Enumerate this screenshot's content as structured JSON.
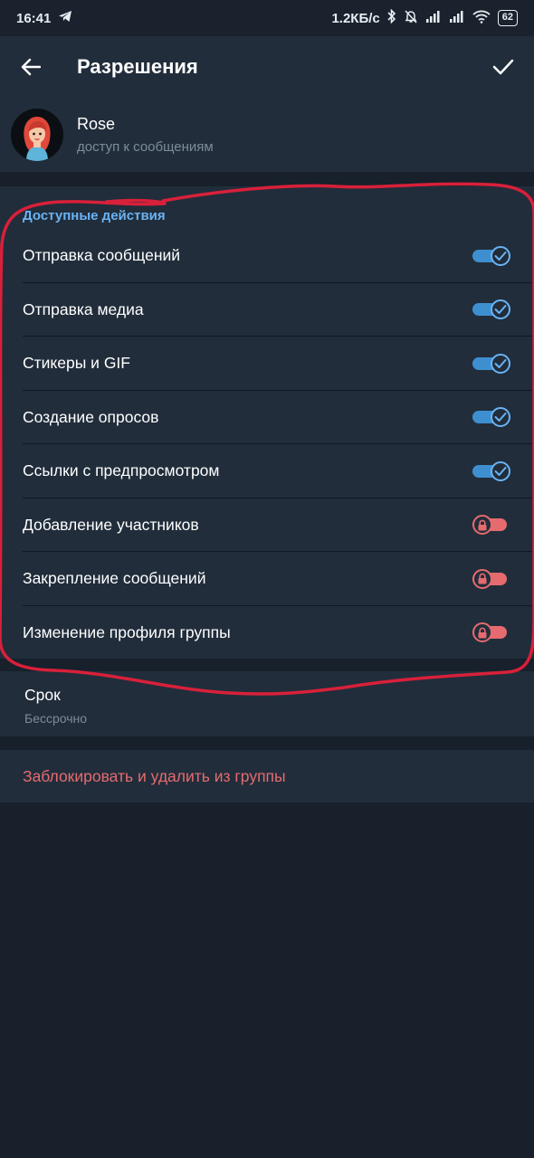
{
  "status_bar": {
    "time": "16:41",
    "network_speed": "1.2КБ/с",
    "battery": "62",
    "icons": [
      "telegram-icon",
      "bluetooth-icon",
      "mute-icon",
      "signal-icon",
      "signal-icon",
      "wifi-icon",
      "battery-icon"
    ]
  },
  "header": {
    "title": "Разрешения",
    "back_icon": "arrow-left-icon",
    "save_icon": "checkmark-icon"
  },
  "user": {
    "name": "Rose",
    "subtitle": "доступ к сообщениям"
  },
  "permissions": {
    "header": "Доступные действия",
    "items": [
      {
        "label": "Отправка сообщений",
        "enabled": true
      },
      {
        "label": "Отправка медиа",
        "enabled": true
      },
      {
        "label": "Стикеры и GIF",
        "enabled": true
      },
      {
        "label": "Создание опросов",
        "enabled": true
      },
      {
        "label": "Ссылки с предпросмотром",
        "enabled": true
      },
      {
        "label": "Добавление участников",
        "enabled": false
      },
      {
        "label": "Закрепление сообщений",
        "enabled": false
      },
      {
        "label": "Изменение профиля группы",
        "enabled": false
      }
    ]
  },
  "duration": {
    "label": "Срок",
    "value": "Бессрочно"
  },
  "ban": {
    "label": "Заблокировать и удалить из группы"
  },
  "colors": {
    "background": "#17202b",
    "surface": "#212d3b",
    "accent": "#6ab3f3",
    "toggle_on": "#3e8fd0",
    "destructive": "#e56b6f",
    "annotation": "#d9203a"
  }
}
